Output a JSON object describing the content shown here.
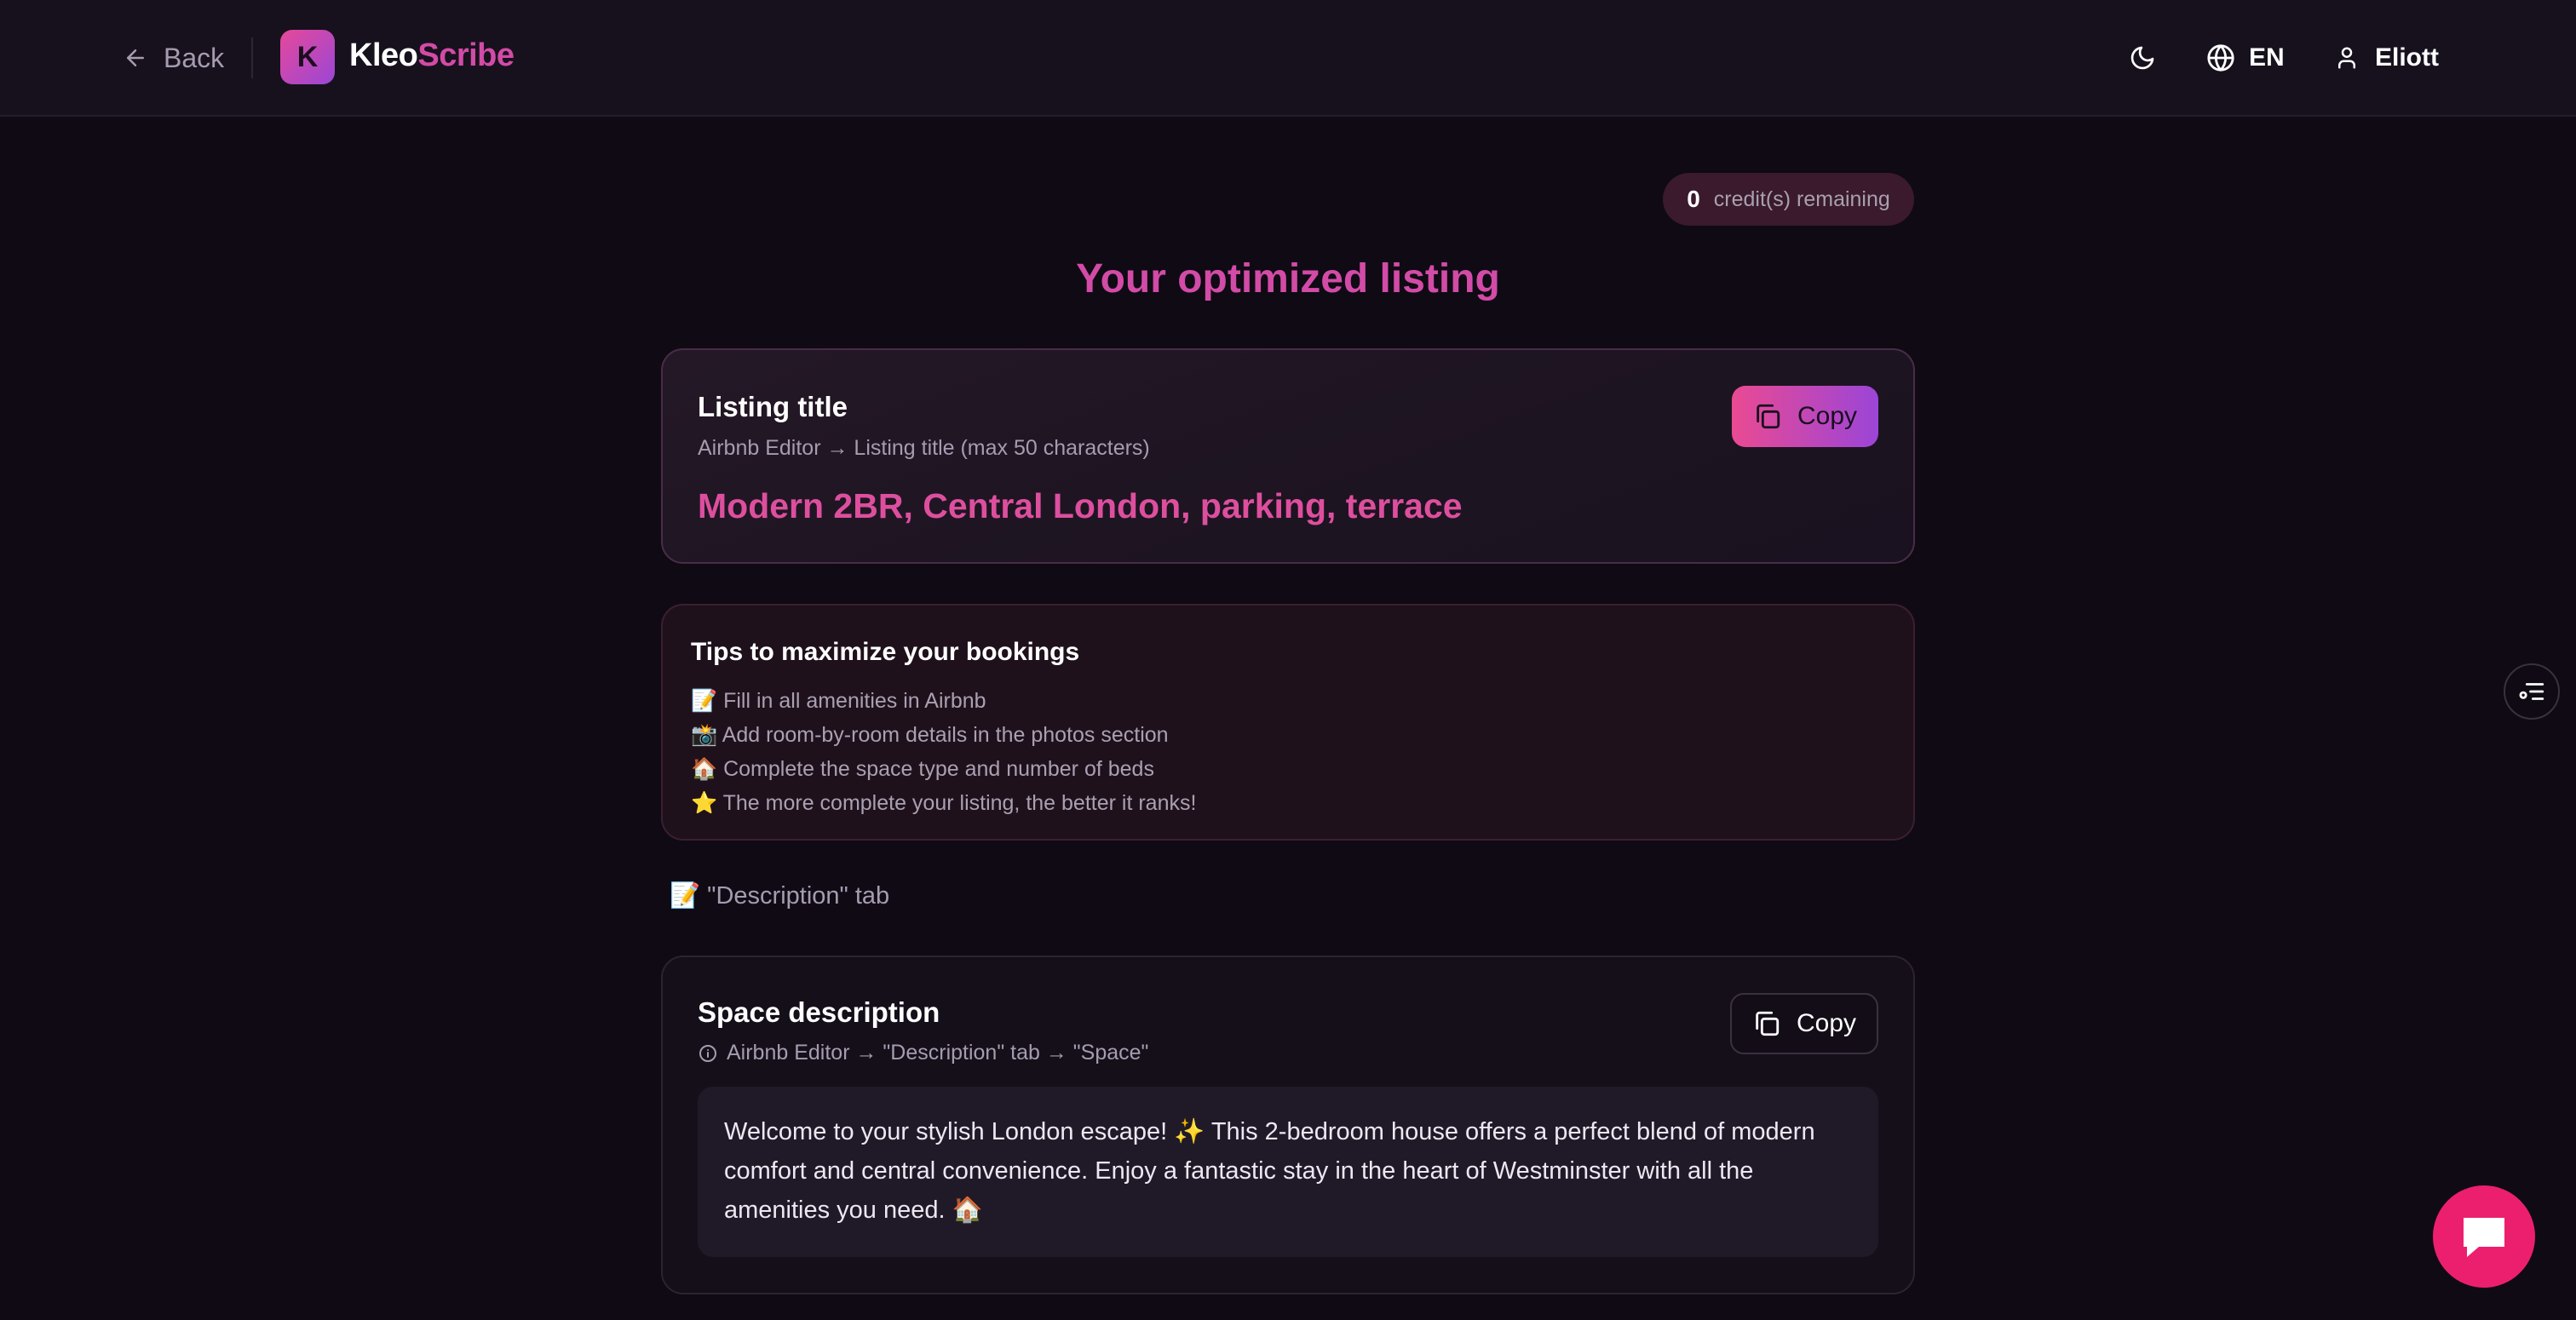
{
  "header": {
    "back_label": "Back",
    "logo_letter": "K",
    "brand_part1": "Kleo",
    "brand_part2": "Scribe",
    "language": "EN",
    "user_name": "Eliott"
  },
  "credits": {
    "count": "0",
    "label": "credit(s) remaining"
  },
  "page_title": "Your optimized listing",
  "listing_title_card": {
    "heading": "Listing title",
    "path": "Airbnb Editor → Listing title (max 50 characters)",
    "value": "Modern 2BR, Central London, parking, terrace",
    "copy_label": "Copy"
  },
  "tips": {
    "heading": "Tips to maximize your bookings",
    "items": [
      "📝 Fill in all amenities in Airbnb",
      "📸 Add room-by-room details in the photos section",
      "🏠 Complete the space type and number of beds",
      "⭐ The more complete your listing, the better it ranks!"
    ]
  },
  "description_section": {
    "label": "📝 \"Description\" tab"
  },
  "space_card": {
    "heading": "Space description",
    "path": "Airbnb Editor → \"Description\" tab → \"Space\"",
    "copy_label": "Copy",
    "text": "Welcome to your stylish London escape! ✨ This 2-bedroom house offers a perfect blend of modern comfort and central convenience. Enjoy a fantastic stay in the heart of Westminster with all the amenities you need. 🏠"
  },
  "colors": {
    "accent_pink": "#d24ba6",
    "gradient_start": "#ea4a92",
    "gradient_end": "#9b45d8",
    "chat_fab": "#ec1f6e",
    "background": "#0f0a14"
  },
  "icons": {
    "back": "arrow-left-icon",
    "theme": "moon-icon",
    "language": "globe-icon",
    "user": "user-icon",
    "copy": "copy-icon",
    "info": "info-icon",
    "side_toggle": "settings-list-icon",
    "chat": "chat-bubble-icon"
  }
}
